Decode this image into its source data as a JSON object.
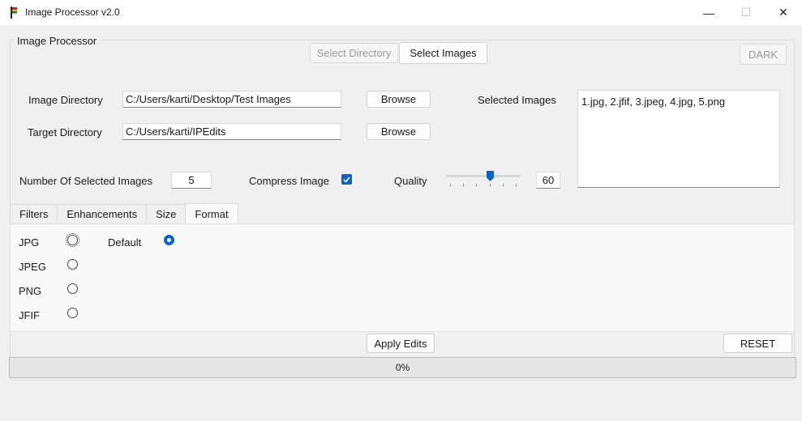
{
  "window": {
    "title": "Image Processor v2.0",
    "minimize_glyph": "—",
    "maximize_glyph": "☐",
    "close_glyph": "✕"
  },
  "group": {
    "title": "Image Processor"
  },
  "header": {
    "select_directory": "Select Directory",
    "select_images": "Select Images",
    "dark": "DARK"
  },
  "form": {
    "image_directory_label": "Image Directory",
    "image_directory_value": "C:/Users/karti/Desktop/Test Images",
    "target_directory_label": "Target Directory",
    "target_directory_value": "C:/Users/karti/IPEdits",
    "browse": "Browse",
    "selected_images_label": "Selected Images",
    "selected_images_value": "1.jpg, 2.jfif, 3.jpeg, 4.jpg, 5.png",
    "num_selected_label": "Number Of Selected Images",
    "num_selected_value": "5",
    "compress_label": "Compress Image",
    "compress_checked": true,
    "quality_label": "Quality",
    "quality_value": "60",
    "quality_level": 60
  },
  "tabs": [
    {
      "label": "Filters"
    },
    {
      "label": "Enhancements"
    },
    {
      "label": "Size"
    },
    {
      "label": "Format",
      "active": true
    }
  ],
  "format": {
    "options": [
      "JPG",
      "JPEG",
      "PNG",
      "JFIF"
    ],
    "default_label": "Default"
  },
  "footer": {
    "apply": "Apply Edits",
    "reset": "RESET",
    "progress_text": "0%",
    "progress_value": 0
  },
  "colors": {
    "accent": "#0a64c8"
  }
}
